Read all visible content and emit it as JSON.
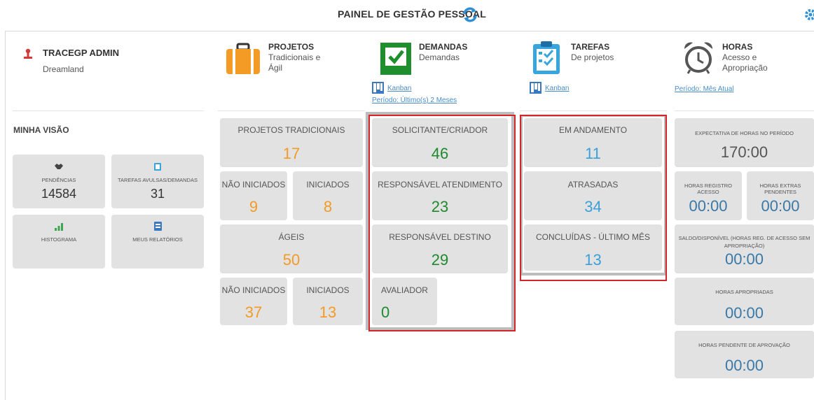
{
  "header": {
    "title": "PAINEL DE GESTÃO PESSOAL"
  },
  "user": {
    "name": "TRACEGP ADMIN",
    "org": "Dreamland"
  },
  "modules": {
    "projetos": {
      "title": "PROJETOS",
      "subtitle": "Tradicionais e Ágil"
    },
    "demandas": {
      "title": "DEMANDAS",
      "subtitle": "Demandas",
      "kanban": "Kanban",
      "period": "Período: Último(s) 2 Meses"
    },
    "tarefas": {
      "title": "TAREFAS",
      "subtitle": "De projetos",
      "kanban": "Kanban"
    },
    "horas": {
      "title": "HORAS",
      "subtitle": "Acesso e Apropriação",
      "period": "Período: Mês Atual"
    }
  },
  "minha_visao": {
    "title": "MINHA VISÃO",
    "pendencias": {
      "label": "PENDÊNCIAS",
      "value": "14584"
    },
    "tarefas_avulsas": {
      "label": "TAREFAS AVULSAS/DEMANDAS",
      "value": "31"
    },
    "histograma": {
      "label": "HISTOGRAMA"
    },
    "relatorios": {
      "label": "MEUS RELATÓRIOS"
    }
  },
  "projetos_stats": {
    "tradicionais": {
      "label": "PROJETOS TRADICIONAIS",
      "value": "17"
    },
    "trad_nao_iniciados": {
      "label": "NÃO INICIADOS",
      "value": "9"
    },
    "trad_iniciados": {
      "label": "INICIADOS",
      "value": "8"
    },
    "ageis": {
      "label": "ÁGEIS",
      "value": "50"
    },
    "ageis_nao_iniciados": {
      "label": "NÃO INICIADOS",
      "value": "37"
    },
    "ageis_iniciados": {
      "label": "INICIADOS",
      "value": "13"
    }
  },
  "demandas_stats": {
    "solicitante": {
      "label": "SOLICITANTE/CRIADOR",
      "value": "46"
    },
    "resp_atendimento": {
      "label": "RESPONSÁVEL ATENDIMENTO",
      "value": "23"
    },
    "resp_destino": {
      "label": "RESPONSÁVEL DESTINO",
      "value": "29"
    },
    "avaliador": {
      "label": "AVALIADOR",
      "value": "0"
    }
  },
  "tarefas_stats": {
    "em_andamento": {
      "label": "EM ANDAMENTO",
      "value": "11"
    },
    "atrasadas": {
      "label": "ATRASADAS",
      "value": "34"
    },
    "concluidas": {
      "label": "CONCLUÍDAS - ÚLTIMO MÊS",
      "value": "13"
    }
  },
  "horas_stats": {
    "expectativa": {
      "label": "EXPECTATIVA DE HORAS NO PERÍODO",
      "value": "170:00"
    },
    "registro_acesso": {
      "label": "HORAS REGISTRO ACESSO",
      "value": "00:00"
    },
    "extras_pendentes": {
      "label": "HORAS EXTRAS PENDENTES",
      "value": "00:00"
    },
    "saldo": {
      "label": "SALDO/DISPONÍVEL (HORAS REG. DE ACESSO SEM APROPRIAÇÃO)",
      "value": "00:00"
    },
    "apropriadas": {
      "label": "HORAS APROPRIADAS",
      "value": "00:00"
    },
    "pendente_aprovacao": {
      "label": "HORAS PENDENTE DE APROVAÇÃO",
      "value": "00:00"
    }
  },
  "colors": {
    "orange": "#f39b25",
    "green": "#1e8a2e",
    "blue": "#3aa0d8",
    "highlight": "#d4262a",
    "tile": "#e2e2e2"
  }
}
